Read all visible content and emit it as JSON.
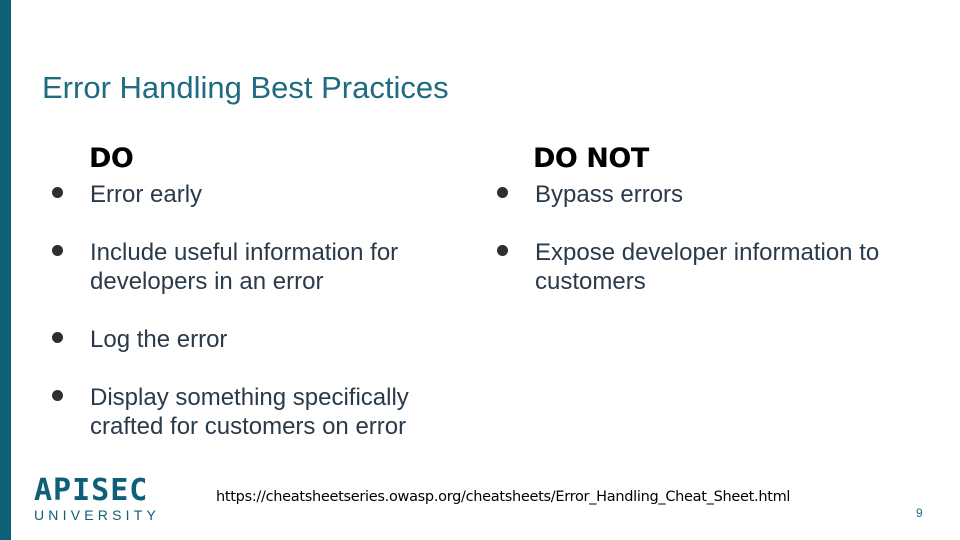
{
  "slide": {
    "title": "Error Handling Best Practices",
    "page_number": "9"
  },
  "do_column": {
    "heading": "DO",
    "items": [
      {
        "text": "Error early"
      },
      {
        "text": "Include useful information for developers in an error"
      },
      {
        "text": "Log the error"
      },
      {
        "text": "Display something specifically crafted for customers on error"
      }
    ]
  },
  "do_not_column": {
    "heading": "DO NOT",
    "items": [
      {
        "text": "Bypass errors"
      },
      {
        "text": "Expose developer information to customers"
      }
    ]
  },
  "footer": {
    "logo_main": "APISEC",
    "logo_sub": "UNIVERSITY",
    "source_url": "https://cheatsheetseries.owasp.org/cheatsheets/Error_Handling_Cheat_Sheet.html"
  },
  "colors": {
    "accent": "#0f5f78",
    "title": "#1f6b82",
    "body_text": "#2a3a4a"
  }
}
